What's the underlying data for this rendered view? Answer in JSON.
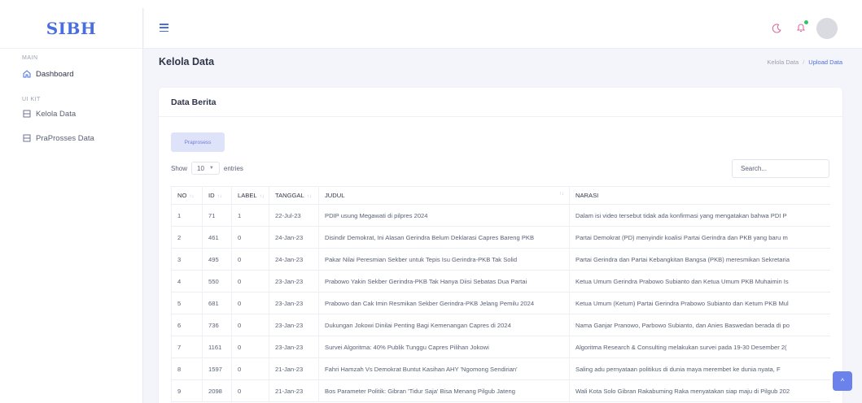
{
  "brand": "SIBH",
  "sidebar": {
    "sections": [
      {
        "label": "MAIN",
        "items": [
          {
            "label": "Dashboard",
            "icon": "home-icon"
          }
        ]
      },
      {
        "label": "UI KIT",
        "items": [
          {
            "label": "Kelola Data",
            "icon": "table-icon"
          },
          {
            "label": "PraProsses Data",
            "icon": "table-icon"
          }
        ]
      }
    ]
  },
  "topbar": {
    "icons": [
      "menu-icon",
      "moon-icon",
      "bell-icon",
      "avatar"
    ]
  },
  "page": {
    "title": "Kelola Data",
    "breadcrumb": {
      "parent": "Kelola Data",
      "separator": "/",
      "current": "Upload Data"
    }
  },
  "card": {
    "title": "Data Berita",
    "preprocess_button": "Praprosess",
    "show_label": "Show",
    "entries_value": "10",
    "entries_label": "entries",
    "search_placeholder": "Search..."
  },
  "table": {
    "sort_glyph": "↑↓",
    "columns": [
      "NO",
      "ID",
      "LABEL",
      "TANGGAL",
      "JUDUL",
      "NARASI"
    ],
    "rows": [
      [
        "1",
        "71",
        "1",
        "22-Jul-23",
        "PDIP usung Megawati di pilpres 2024",
        "Dalam isi video tersebut tidak ada konfirmasi yang mengatakan bahwa PDI P"
      ],
      [
        "2",
        "461",
        "0",
        "24-Jan-23",
        "Disindir Demokrat, Ini Alasan Gerindra Belum Deklarasi Capres Bareng PKB",
        "Partai Demokrat (PD) menyindir koalisi Partai Gerindra dan PKB yang baru m"
      ],
      [
        "3",
        "495",
        "0",
        "24-Jan-23",
        "Pakar Nilai Peresmian Sekber untuk Tepis Isu Gerindra-PKB Tak Solid",
        "Partai Gerindra dan Partai Kebangkitan Bangsa (PKB) meresmikan Sekretaria"
      ],
      [
        "4",
        "550",
        "0",
        "23-Jan-23",
        "Prabowo Yakin Sekber Gerindra-PKB Tak Hanya Diisi Sebatas Dua Partai",
        "Ketua Umum Gerindra Prabowo Subianto dan Ketua Umum PKB Muhaimin Is"
      ],
      [
        "5",
        "681",
        "0",
        "23-Jan-23",
        "Prabowo dan Cak Imin Resmikan Sekber Gerindra-PKB Jelang Pemilu 2024",
        "Ketua Umum (Ketum) Partai Gerindra Prabowo Subianto dan Ketum PKB Mul"
      ],
      [
        "6",
        "736",
        "0",
        "23-Jan-23",
        "Dukungan Jokowi Dinilai Penting Bagi Kemenangan Capres di 2024",
        "Nama Ganjar Pranowo, Parbowo Subianto, dan Anies Baswedan berada di po"
      ],
      [
        "7",
        "1161",
        "0",
        "23-Jan-23",
        "Survei Algoritma: 40% Publik Tunggu Capres Pilihan Jokowi",
        "Algoritma Research & Consulting melakukan survei pada 19-30 Desember 2("
      ],
      [
        "8",
        "1597",
        "0",
        "21-Jan-23",
        "Fahri Hamzah Vs Demokrat Buntut Kasihan AHY 'Ngomong Sendirian'",
        "Saling adu pernyataan politikus di dunia maya merembet ke dunia nyata, F"
      ],
      [
        "9",
        "2098",
        "0",
        "21-Jan-23",
        "Bos Parameter Politik: Gibran 'Tidur Saja' Bisa Menang Pilgub Jateng",
        "Wali Kota Solo Gibran Rakabuming Raka menyatakan siap maju di Pilgub 202"
      ]
    ]
  },
  "scroll_top_glyph": "^"
}
